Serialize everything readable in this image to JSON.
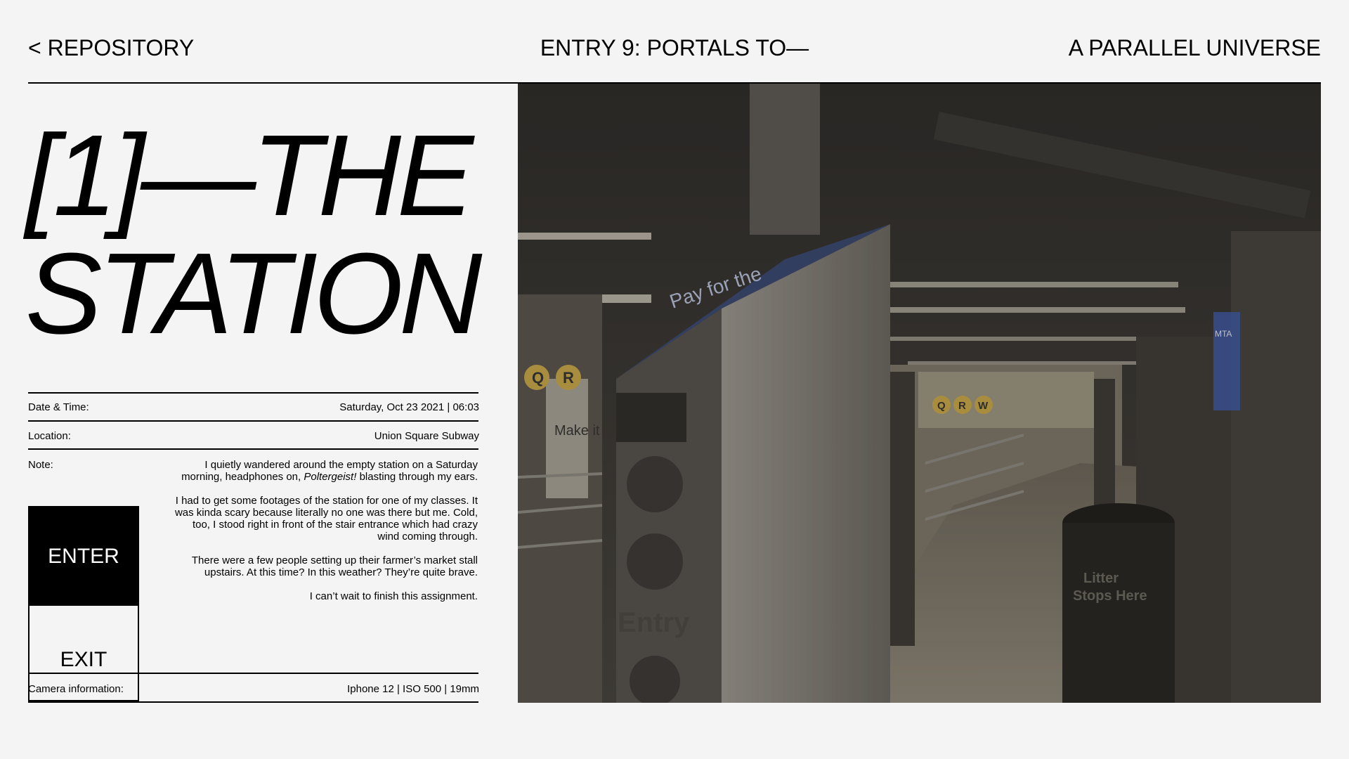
{
  "nav": {
    "back_label": "< REPOSITORY",
    "title": "ENTRY 9: PORTALS TO—",
    "right_label": "A PARALLEL UNIVERSE"
  },
  "headline": {
    "line1": "[1]—THE",
    "line2": "STATION"
  },
  "meta": {
    "datetime_label": "Date & Time:",
    "datetime_value": "Saturday, Oct 23 2021 | 06:03",
    "location_label": "Location:",
    "location_value": "Union Square Subway",
    "note_label": "Note:",
    "note_p1_before": "I quietly wandered around the empty station on a Saturday morning, headphones on, ",
    "note_p1_italic": "Poltergeist!",
    "note_p1_after": " blasting through my ears.",
    "note_p2": "I had to get some footages of the station for one of my classes. It was kinda scary because literally no one was there but me. Cold, too, I stood right in front of the stair entrance which had crazy wind coming through.",
    "note_p3": "There were a few people setting up their farmer’s market stall upstairs. At this time? In this weather? They’re quite brave.",
    "note_p4": "I can’t wait to finish this assignment.",
    "camera_label": "Camera information:",
    "camera_value": "Iphone 12 | ISO 500 | 19mm"
  },
  "buttons": {
    "enter": "ENTER",
    "exit": "EXIT"
  },
  "photo": {
    "sign_pay": "Pay for the",
    "sign_make": "Make it",
    "sign_entry": "Entry",
    "sign_litter1": "Litter",
    "sign_litter2": "Stops Here",
    "sign_mta": "MTA",
    "line_q": "Q",
    "line_r": "R",
    "line_w": "W"
  },
  "colors": {
    "background": "#f4f4f4",
    "ink": "#000000",
    "line_badge": "#c9a84a",
    "sign_blue": "#3d5aa8"
  }
}
